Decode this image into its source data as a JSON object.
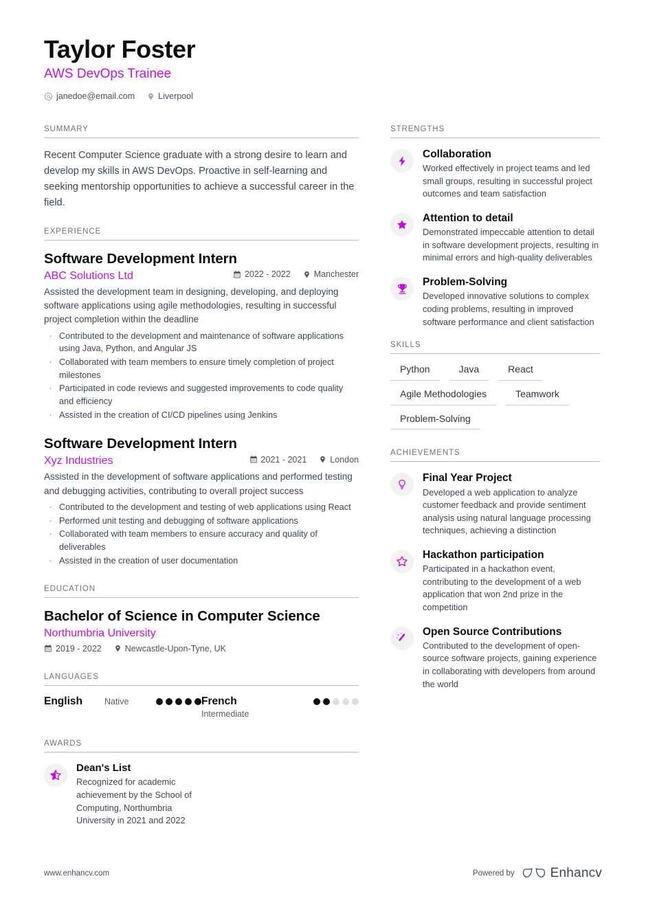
{
  "accent_color": "#c210dc",
  "header": {
    "name": "Taylor Foster",
    "job_title": "AWS DevOps Trainee",
    "email": "janedoe@email.com",
    "location": "Liverpool"
  },
  "summary": {
    "title": "SUMMARY",
    "text": "Recent Computer Science graduate with a strong desire to learn and develop my skills in AWS DevOps. Proactive in self-learning and seeking mentorship opportunities to achieve a successful career in the field."
  },
  "experience": {
    "title": "EXPERIENCE",
    "entries": [
      {
        "role": "Software Development Intern",
        "company": "ABC Solutions Ltd",
        "dates": "2022 - 2022",
        "location": "Manchester",
        "description": "Assisted the development team in designing, developing, and deploying software applications using agile methodologies, resulting in successful project completion within the deadline",
        "bullets": [
          "Contributed to the development and maintenance of software applications using Java, Python, and Angular JS",
          "Collaborated with team members to ensure timely completion of project milestones",
          "Participated in code reviews and suggested improvements to code quality and efficiency",
          "Assisted in the creation of CI/CD pipelines using Jenkins"
        ]
      },
      {
        "role": "Software Development Intern",
        "company": "Xyz Industries",
        "dates": "2021 - 2021",
        "location": "London",
        "description": "Assisted in the development of software applications and performed testing and debugging activities, contributing to overall project success",
        "bullets": [
          "Contributed to the development and testing of web applications using React",
          "Performed unit testing and debugging of software applications",
          "Collaborated with team members to ensure accuracy and quality of deliverables",
          "Assisted in the creation of user documentation"
        ]
      }
    ]
  },
  "education": {
    "title": "EDUCATION",
    "entries": [
      {
        "degree": "Bachelor of Science in Computer Science",
        "school": "Northumbria University",
        "dates": "2019 - 2022",
        "location": "Newcastle-Upon-Tyne, UK"
      }
    ]
  },
  "languages": {
    "title": "LANGUAGES",
    "items": [
      {
        "name": "English",
        "level": "Native",
        "dots_filled": 5,
        "dots_total": 5
      },
      {
        "name": "French",
        "level": "Intermediate",
        "dots_filled": 2,
        "dots_total": 5
      }
    ]
  },
  "awards": {
    "title": "AWARDS",
    "items": [
      {
        "icon": "half-star-icon",
        "name": "Dean's List",
        "description": "Recognized for academic achievement by the School of Computing, Northumbria University in 2021 and 2022"
      }
    ]
  },
  "strengths": {
    "title": "STRENGTHS",
    "items": [
      {
        "icon": "lightning-bolt-icon",
        "name": "Collaboration",
        "description": "Worked effectively in project teams and led small groups, resulting in successful project outcomes and team satisfaction"
      },
      {
        "icon": "star-filled-icon",
        "name": "Attention to detail",
        "description": "Demonstrated impeccable attention to detail in software development projects, resulting in minimal errors and high-quality deliverables"
      },
      {
        "icon": "trophy-icon",
        "name": "Problem-Solving",
        "description": "Developed innovative solutions to complex coding problems, resulting in improved software performance and client satisfaction"
      }
    ]
  },
  "skills": {
    "title": "SKILLS",
    "rows": [
      [
        "Python",
        "Java",
        "React"
      ],
      [
        "Agile Methodologies",
        "Teamwork"
      ],
      [
        "Problem-Solving"
      ]
    ]
  },
  "achievements": {
    "title": "ACHIEVEMENTS",
    "items": [
      {
        "icon": "lightbulb-icon",
        "name": "Final Year Project",
        "description": "Developed a web application to analyze customer feedback and provide sentiment analysis using natural language processing techniques, achieving a distinction"
      },
      {
        "icon": "star-outline-icon",
        "name": "Hackathon participation",
        "description": "Participated in a hackathon event, contributing to the development of a web application that won 2nd prize in the competition"
      },
      {
        "icon": "magic-wand-icon",
        "name": "Open Source Contributions",
        "description": "Contributed to the development of open-source software projects, gaining experience in collaborating with developers from around the world"
      }
    ]
  },
  "footer": {
    "website": "www.enhancv.com",
    "powered_by": "Powered by",
    "brand": "Enhancv"
  }
}
